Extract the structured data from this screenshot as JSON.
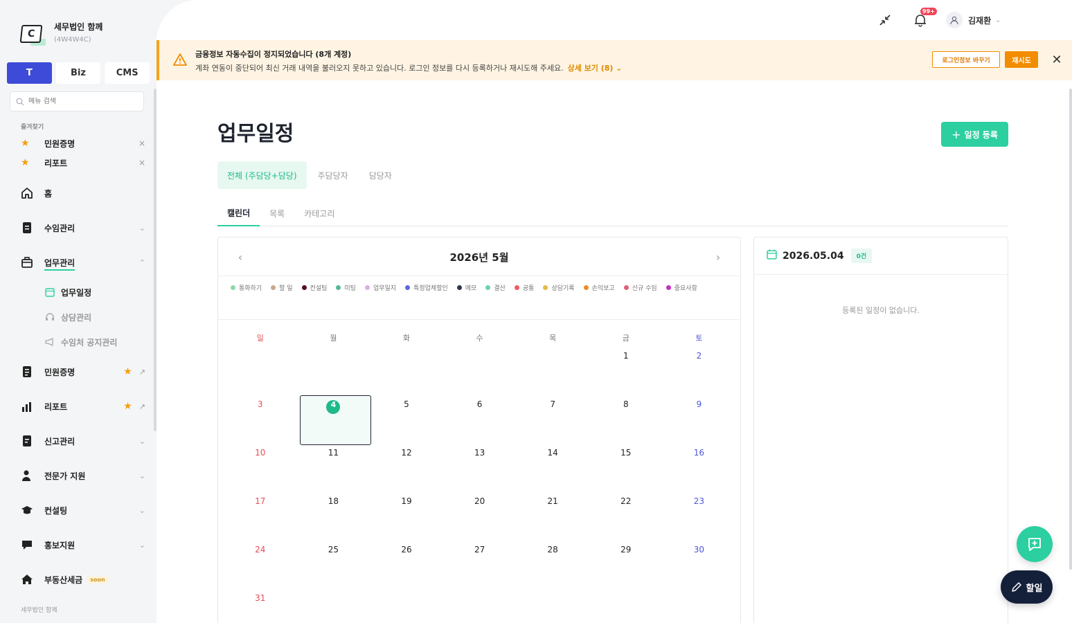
{
  "brand": {
    "name": "세무법인 함께",
    "code": "(4W4W4C)",
    "logo_letter": "C"
  },
  "mode_tabs": [
    {
      "label": "T",
      "active": true
    },
    {
      "label": "Biz",
      "active": false
    },
    {
      "label": "CMS",
      "active": false
    }
  ],
  "search": {
    "placeholder": "메뉴 검색"
  },
  "favorites": {
    "title": "즐겨찾기",
    "items": [
      {
        "label": "민원증명"
      },
      {
        "label": "리포트"
      }
    ]
  },
  "nav": {
    "home": "홈",
    "fee": "수임관리",
    "work": "업무관리",
    "work_sub": [
      "업무일정",
      "상담관리",
      "수임처 공지관리"
    ],
    "civil": "민원증명",
    "report": "리포트",
    "filing": "신고관리",
    "expert": "전문가 지원",
    "consult": "컨설팅",
    "promo": "홍보지원",
    "realestate": "부동산세금",
    "soon": "soon"
  },
  "footer": "세무법인 함께",
  "topbar": {
    "badge": "99+",
    "user": "김재환"
  },
  "alert": {
    "title": "금융정보 자동수집이 정지되었습니다 (8개 계정)",
    "desc": "계좌 연동이 중단되어 최신 거래 내역을 불러오지 못하고 있습니다. 로그인 정보를 다시 등록하거나 재시도해 주세요.",
    "more": "상세 보기 (8) ⌄",
    "btn_change": "로그인정보 바꾸기",
    "btn_retry": "재시도"
  },
  "page": {
    "title": "업무일정",
    "add_button": "일정 등록"
  },
  "scope_tabs": [
    "전체 (주담당+담당)",
    "주담당자",
    "담당자"
  ],
  "view_tabs": [
    "캘린더",
    "목록",
    "카테고리"
  ],
  "calendar": {
    "month_label": "2026년 5월",
    "weekdays": [
      "일",
      "월",
      "화",
      "수",
      "목",
      "금",
      "토"
    ],
    "first_weekday": 5,
    "days_in_month": 31,
    "today": 4,
    "legend": [
      {
        "label": "통화하기",
        "color": "#8fd9a8"
      },
      {
        "label": "할 일",
        "color": "#c9a98c"
      },
      {
        "label": "컨설팅",
        "color": "#5a0a2a"
      },
      {
        "label": "미팅",
        "color": "#55b89a"
      },
      {
        "label": "업무일지",
        "color": "#d6b3e0"
      },
      {
        "label": "특정업체할인",
        "color": "#5a6adf"
      },
      {
        "label": "메모",
        "color": "#2d3550"
      },
      {
        "label": "결산",
        "color": "#6ed0b0"
      },
      {
        "label": "공통",
        "color": "#ef5b65"
      },
      {
        "label": "상담기록",
        "color": "#e8b84a"
      },
      {
        "label": "손익보고",
        "color": "#ee8a2a"
      },
      {
        "label": "신규 수임",
        "color": "#e0607a"
      },
      {
        "label": "중요사항",
        "color": "#c42fc4"
      }
    ]
  },
  "detail": {
    "date": "2026.05.04",
    "count": "0건",
    "empty": "등록된 일정이 없습니다."
  },
  "fab": {
    "todo": "할일"
  }
}
